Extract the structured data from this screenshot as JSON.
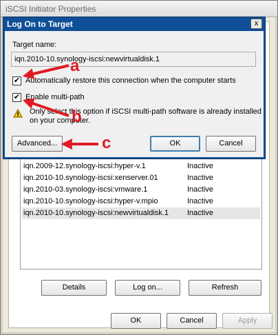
{
  "parent_window": {
    "title": "iSCSI Initiator Properties",
    "targets": [
      {
        "name": "iqn.2009-12.synology-iscsi:hyper-v.1",
        "status": "Inactive"
      },
      {
        "name": "iqn.2010-10.synology-iscsi:xenserver.01",
        "status": "Inactive"
      },
      {
        "name": "iqn.2010-03.synology-iscsi:vmware.1",
        "status": "Inactive"
      },
      {
        "name": "iqn.2010-10.synology-iscsi:hyper-v.mpio",
        "status": "Inactive"
      },
      {
        "name": "iqn.2010-10.synology-iscsi:newvirtualdisk.1",
        "status": "Inactive"
      }
    ],
    "buttons": {
      "details": "Details",
      "log_on": "Log on...",
      "refresh": "Refresh"
    },
    "footer": {
      "ok": "OK",
      "cancel": "Cancel",
      "apply": "Apply"
    }
  },
  "dialog": {
    "title": "Log On to Target",
    "close_glyph": "x",
    "target_name_label": "Target name:",
    "target_name_value": "iqn.2010-10.synology-iscsi:newvirtualdisk.1",
    "auto_restore": {
      "label": "Automatically restore this connection when the computer starts",
      "checked": true
    },
    "multipath": {
      "label": "Enable multi-path",
      "checked": true
    },
    "warning_line1": "Only select this option if iSCSI multi-path software is already installed",
    "warning_line2": "on your computer.",
    "buttons": {
      "advanced": "Advanced...",
      "ok": "OK",
      "cancel": "Cancel"
    }
  },
  "annotations": {
    "a": "a",
    "b": "b",
    "c": "c",
    "color": "#e01b24"
  }
}
